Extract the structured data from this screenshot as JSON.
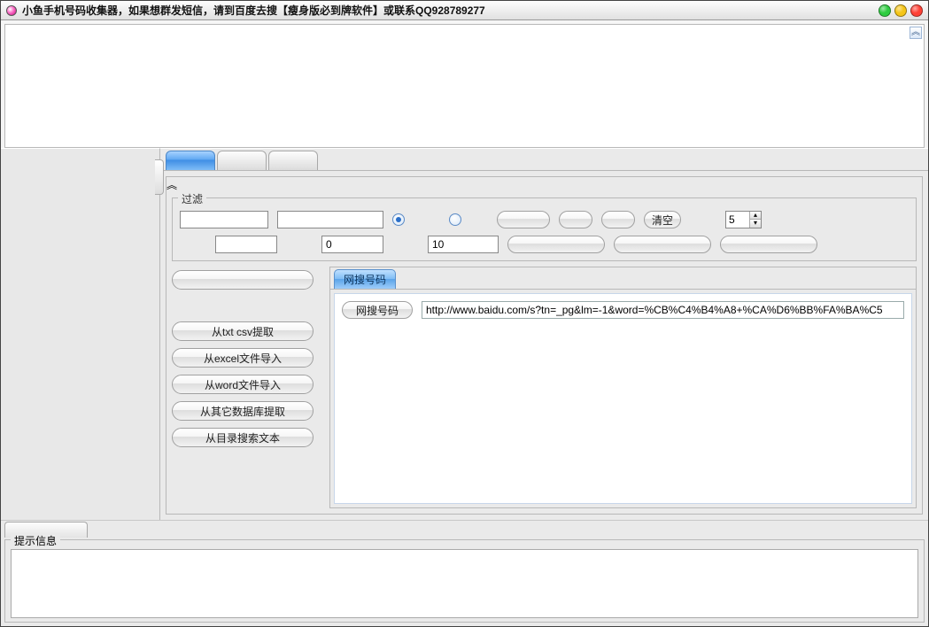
{
  "window": {
    "title": "小鱼手机号码收集器，如果想群发短信，请到百度去搜【瘦身版必到牌软件】或联系QQ928789277"
  },
  "filter": {
    "legend": "过滤",
    "row1": {
      "input1": "",
      "input2": "",
      "radio1_checked": true,
      "radio2_checked": false,
      "btn1": "",
      "btn2": "",
      "btn3": "",
      "clear": "清空",
      "spinner": "5"
    },
    "row2": {
      "input1": "",
      "input2": "0",
      "input3": "10",
      "btn1": "",
      "btn2": "",
      "btn3": ""
    }
  },
  "source": {
    "btn_blank": "",
    "buttons": [
      "从txt csv提取",
      "从excel文件导入",
      "从word文件导入",
      "从其它数据库提取",
      "从目录搜索文本"
    ]
  },
  "search": {
    "tab_label": "网搜号码",
    "action_label": "网搜号码",
    "url": "http://www.baidu.com/s?tn=_pg&lm=-1&word=%CB%C4%B4%A8+%CA%D6%BB%FA%BA%C5"
  },
  "hint": {
    "legend": "提示信息"
  }
}
